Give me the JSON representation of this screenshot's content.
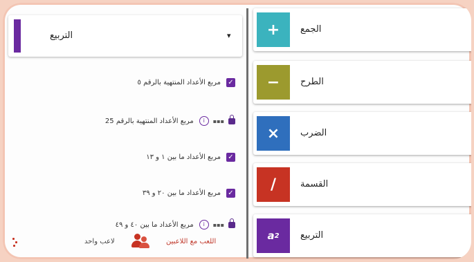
{
  "colors": {
    "add": "#3bb3be",
    "subtract": "#9c9a2e",
    "multiply": "#2f6fbd",
    "divide": "#c73323",
    "square": "#6a2aa0"
  },
  "operations": [
    {
      "label": "الجمع",
      "symbol": "+",
      "icon": "plus-icon"
    },
    {
      "label": "الطرح",
      "symbol": "−",
      "icon": "minus-icon"
    },
    {
      "label": "الضرب",
      "symbol": "×",
      "icon": "times-icon"
    },
    {
      "label": "القسمة",
      "symbol": "/",
      "icon": "divide-icon"
    },
    {
      "label": "التربيع",
      "symbol": "a",
      "icon": "square-icon"
    }
  ],
  "dropdown": {
    "selected": "التربيع",
    "icon": "chevron-down-icon"
  },
  "list": [
    {
      "text": "مربع الأعداد المنتهية بالرقم ٥",
      "state": "checked"
    },
    {
      "text": "مربع الأعداد المنتهية بالرقم 25",
      "state": "locked"
    },
    {
      "text": "مربع الأعداد ما بين ١ و ١٣",
      "state": "checked"
    },
    {
      "text": "مربع الأعداد ما بين ٢٠ و ٣٩",
      "state": "checked"
    },
    {
      "text": "مربع الأعداد ما بين ٤٠ و ٤٩",
      "state": "locked"
    }
  ],
  "footer": {
    "multi_player": "اللعب مع اللاعبين",
    "single_player": "لاعب واحد"
  }
}
